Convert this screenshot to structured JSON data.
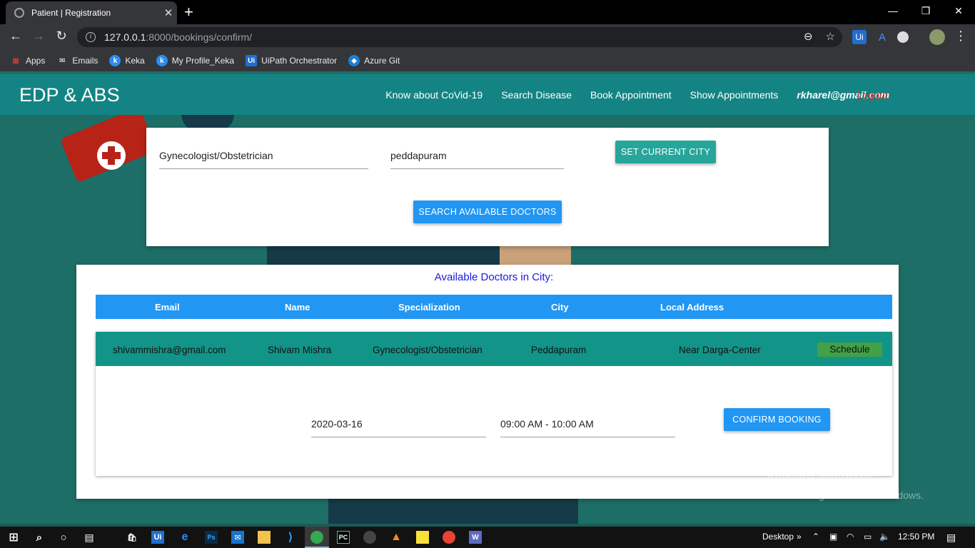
{
  "browser": {
    "tab_title": "Patient | Registration",
    "tab_close": "✕",
    "new_tab": "+",
    "url_host": "127.0.0.1",
    "url_path": ":8000/bookings/confirm/",
    "bookmarks": [
      {
        "label": "Apps",
        "icon": "apps-grid-icon",
        "color": "#ea4335"
      },
      {
        "label": "Emails",
        "icon": "envelope-icon",
        "color": "#ffffff"
      },
      {
        "label": "Keka",
        "icon": "keka-icon",
        "color": "#2d8cf0"
      },
      {
        "label": "My Profile_Keka",
        "icon": "keka-icon",
        "color": "#2d8cf0"
      },
      {
        "label": "UiPath Orchestrator",
        "icon": "uipath-icon",
        "color": "#1f6fd1"
      },
      {
        "label": "Azure Git",
        "icon": "azure-devops-icon",
        "color": "#1b7fd4"
      }
    ]
  },
  "navbar": {
    "brand": "EDP & ABS",
    "links": [
      "Know about CoVid-19",
      "Search Disease",
      "Book Appointment",
      "Show Appointments"
    ],
    "user_email": "rkharel@gmail.com",
    "logout": "Logout"
  },
  "search": {
    "specialization": "Gynecologist/Obstetrician",
    "city": "peddapuram",
    "set_city_label": "SET CURRENT CITY",
    "search_label": "SEARCH AVAILABLE DOCTORS"
  },
  "results": {
    "title": "Available Doctors in City:",
    "columns": [
      "Email",
      "Name",
      "Specialization",
      "City",
      "Local Address"
    ],
    "doctor": {
      "email": "shivammishra@gmail.com",
      "name": "Shivam Mishra",
      "specialization": "Gynecologist/Obstetrician",
      "city": "Peddapuram",
      "address": "Near Darga-Center",
      "schedule_label": "Schedule"
    },
    "booking": {
      "date": "2020-03-16",
      "slot": "09:00 AM - 10:00 AM",
      "confirm_label": "CONFIRM BOOKING"
    }
  },
  "watermark": {
    "line1": "Activate Windows",
    "line2": "Go to Settings to activate Windows."
  },
  "taskbar": {
    "desktop_label": "Desktop",
    "time": "12:50 PM"
  },
  "colors": {
    "navbar": "#138483",
    "teal_button": "#26a69a",
    "blue_button": "#2196f3",
    "logout": "#e0241b"
  }
}
